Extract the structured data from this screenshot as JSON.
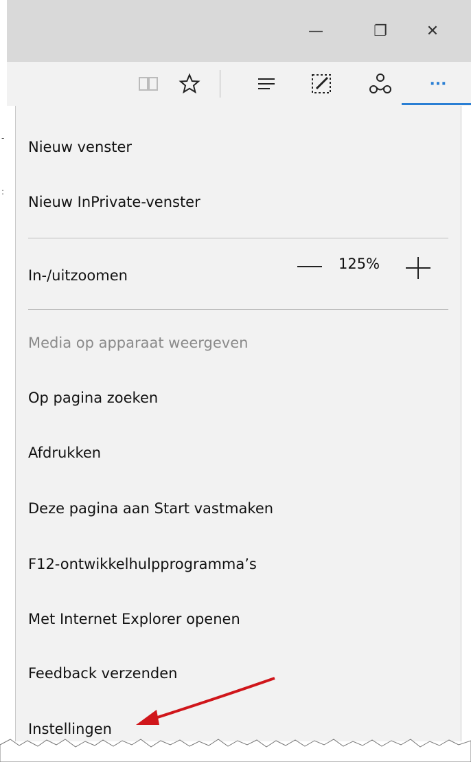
{
  "titlebar": {
    "minimize": "—",
    "restore": "❐",
    "close": "✕"
  },
  "toolbar": {
    "more_label": "···"
  },
  "zoom": {
    "label": "In-/uitzoomen",
    "value": "125%"
  },
  "menu": {
    "new_window": "Nieuw venster",
    "new_inprivate": "Nieuw InPrivate-venster",
    "cast_media": "Media op apparaat weergeven",
    "find_on_page": "Op pagina zoeken",
    "print": "Afdrukken",
    "pin_to_start": "Deze pagina aan Start vastmaken",
    "f12_tools": "F12-ontwikkelhulpprogramma’s",
    "open_ie": "Met Internet Explorer openen",
    "send_feedback": "Feedback verzenden",
    "settings": "Instellingen"
  },
  "colors": {
    "accent": "#2a7fd4",
    "arrow": "#d0161b",
    "menu_bg": "#f2f2f2",
    "titlebar_bg": "#d9d9d9"
  },
  "icons": [
    "reading-view-icon",
    "favorite-star-icon",
    "hub-icon",
    "web-note-icon",
    "share-icon",
    "more-icon"
  ]
}
